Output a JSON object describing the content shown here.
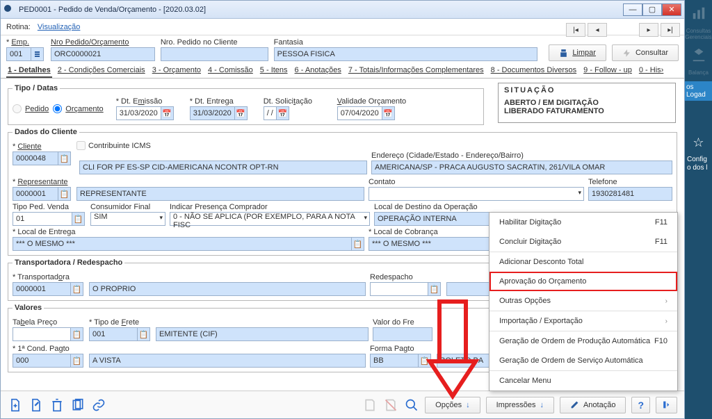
{
  "window": {
    "title": "PED0001 - Pedido de Venda/Orçamento - [2020.03.02]",
    "routine_label": "Rotina:",
    "routine_value": "Visualização"
  },
  "header": {
    "emp_label": "Emp.",
    "emp_value": "001",
    "nro_pedido_label": "Nro Pedido/Orçamento",
    "nro_pedido_value": "ORC0000021",
    "nro_cliente_label": "Nro. Pedido no Cliente",
    "nro_cliente_value": "",
    "fantasia_label": "Fantasia",
    "fantasia_value": "PESSOA FISICA",
    "limpar": "Limpar",
    "consultar": "Consultar"
  },
  "tabs": [
    {
      "key": "1",
      "label": "1 - Detalhes"
    },
    {
      "key": "2",
      "label": "2 - Condições Comerciais"
    },
    {
      "key": "3",
      "label": "3 - Orçamento"
    },
    {
      "key": "4",
      "label": "4 - Comissão"
    },
    {
      "key": "5",
      "label": "5 - Itens"
    },
    {
      "key": "6",
      "label": "6 - Anotações"
    },
    {
      "key": "7",
      "label": "7 - Totais/Informações Complementares"
    },
    {
      "key": "8",
      "label": "8 - Documentos Diversos"
    },
    {
      "key": "9",
      "label": "9 - Follow - up"
    },
    {
      "key": "0",
      "label": "0 - His›"
    }
  ],
  "tipo_datas": {
    "legend": "Tipo / Datas",
    "pedido": "Pedido",
    "orcamento": "Orçamento",
    "dt_emissao_label": "Dt. Emissão",
    "dt_emissao": "31/03/2020",
    "dt_entrega_label": "Dt. Entrega",
    "dt_entrega": "31/03/2020",
    "dt_solicitacao_label": "Dt. Solicitação",
    "dt_solicitacao": "  /  /",
    "validade_label": "Validade Orçamento",
    "validade": "07/04/2020"
  },
  "situacao": {
    "legend": "SITUAÇÃO",
    "line1": "ABERTO / EM DIGITAÇÃO",
    "line2": "LIBERADO FATURAMENTO"
  },
  "cliente": {
    "legend": "Dados do Cliente",
    "cliente_label": "Cliente",
    "cliente_code": "0000048",
    "cliente_nome": "CLI FOR PF ES-SP CID-AMERICANA NCONTR OPT-RN",
    "contrib_icms": "Contribuinte ICMS",
    "endereco_label": "Endereço (Cidade/Estado - Endereço/Bairro)",
    "endereco": "AMERICANA/SP - PRACA AUGUSTO SACRATIN, 261/VILA OMAR",
    "rep_label": "Representante",
    "rep_code": "0000001",
    "rep_nome": "REPRESENTANTE",
    "contato_label": "Contato",
    "contato": "",
    "telefone_label": "Telefone",
    "telefone": "1930281481",
    "tipo_ped_label": "Tipo Ped. Venda",
    "tipo_ped": "01",
    "cons_final_label": "Consumidor Final",
    "cons_final": "SIM",
    "presenca_label": "Indicar Presença Comprador",
    "presenca": "0 - NÃO SE APLICA (POR EXEMPLO, PARA A NOTA FISC",
    "destino_label": "Local de Destino da Operação",
    "destino": "OPERAÇÃO INTERNA",
    "local_entrega_label": "Local de Entrega",
    "local_entrega": "*** O MESMO ***",
    "local_cobranca_label": "Local de Cobrança",
    "local_cobranca": "*** O MESMO ***"
  },
  "transp": {
    "legend": "Transportadora / Redespacho",
    "trans_label": "Transportadora",
    "trans_code": "0000001",
    "trans_nome": "O PROPRIO",
    "redespacho_label": "Redespacho",
    "redespacho": ""
  },
  "valores": {
    "legend": "Valores",
    "tabela_label": "Tabela Preço",
    "tabela": "",
    "tipo_frete_label": "Tipo de Frete",
    "tipo_frete_code": "001",
    "tipo_frete_nome": "EMITENTE (CIF)",
    "valor_frete_label": "Valor do Fre",
    "cond_pagto_label": "1ª Cond. Pagto",
    "cond_pagto_code": "000",
    "cond_pagto_nome": "A VISTA",
    "forma_pagto_label": "Forma Pagto",
    "forma_pagto_code": "BB",
    "forma_pagto_nome": "BOLETO BA"
  },
  "footer": {
    "opcoes": "Opções",
    "impressoes": "Impressões",
    "anotacao": "Anotação"
  },
  "menu": {
    "habilitar": "Habilitar Digitação",
    "f11": "F11",
    "concluir": "Concluir Digitação",
    "desconto": "Adicionar Desconto Total",
    "aprovacao": "Aprovação do Orçamento",
    "outras": "Outras Opções",
    "importacao": "Importação / Exportação",
    "ger_prod": "Geração de Ordem de Produção Automática",
    "f10": "F10",
    "ger_serv": "Geração de Ordem de Serviço Automática",
    "cancelar": "Cancelar Menu"
  },
  "side": {
    "consultas": "Consultas Gerenciais",
    "balanca": "Balança",
    "logado": "os Logad",
    "config": "Config o dos l"
  }
}
